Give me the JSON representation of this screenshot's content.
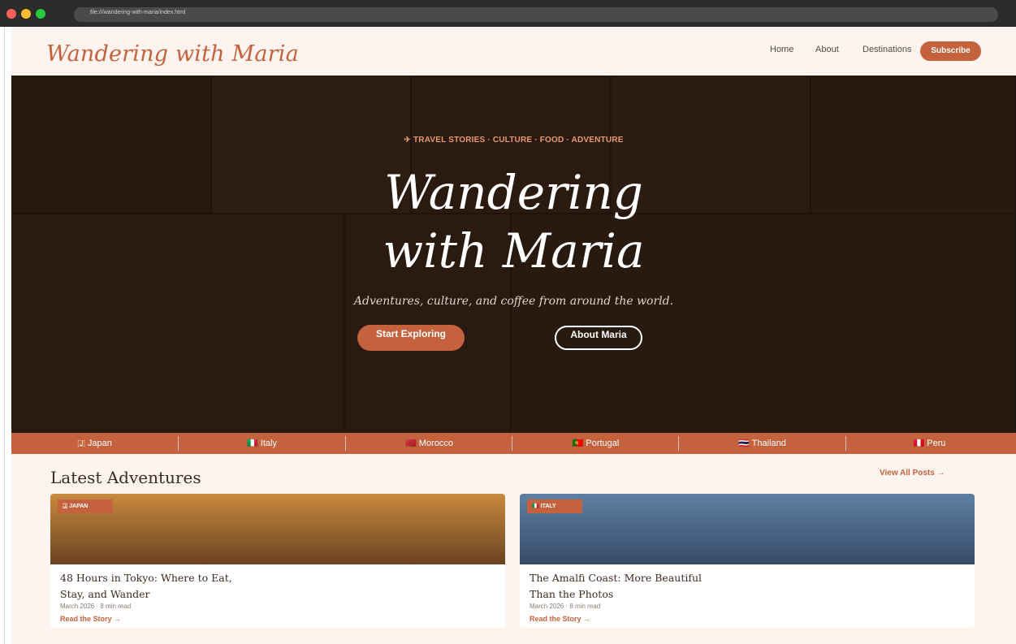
{
  "browser": {
    "url": "file:///wandering-with-maria/index.html"
  },
  "header": {
    "logo": "Wandering with Maria",
    "nav": [
      "Home",
      "About",
      "Destinations"
    ],
    "subscribe_label": "Subscribe"
  },
  "hero": {
    "eyebrow": "✈ TRAVEL STORIES · CULTURE · FOOD · ADVENTURE",
    "title_line1": "Wandering",
    "title_line2": "with Maria",
    "subtitle": "Adventures, culture, and coffee from around the world.",
    "primary_button": "Start Exploring",
    "secondary_button": "About Maria"
  },
  "destinations": [
    "🇯 Japan",
    "🇮🇹 Italy",
    "🇲🇦 Morocco",
    "🇵🇹 Portugal",
    "🇹🇭 Thailand",
    "🇵🇪 Peru"
  ],
  "latest": {
    "heading": "Latest Adventures",
    "view_all": "View All Posts →",
    "posts": [
      {
        "tag": "🇯 JAPAN",
        "title": "48 Hours in Tokyo: Where to Eat, Stay, and Wander",
        "meta": "March 2026 · 8 min read",
        "link": "Read the Story →"
      },
      {
        "tag": "🇮🇹 ITALY",
        "title": "The Amalfi Coast: More Beautiful Than the Photos",
        "meta": "March 2026 · 8 min read",
        "link": "Read the Story →"
      }
    ]
  },
  "colors": {
    "accent": "#c4623e",
    "hero_bg": "#2a1a10",
    "page_bg": "#fdf4ef"
  }
}
